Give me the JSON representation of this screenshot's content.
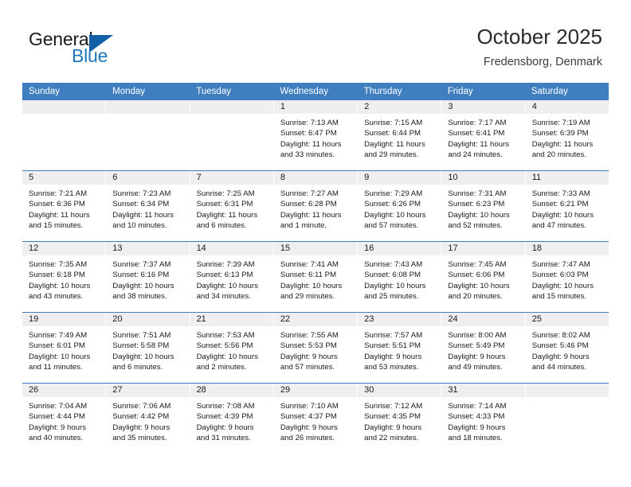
{
  "brand": {
    "name_part1": "General",
    "name_part2": "Blue",
    "accent_color": "#1360a8",
    "text_color": "#1f76bc"
  },
  "header": {
    "title": "October 2025",
    "subtitle": "Fredensborg, Denmark",
    "header_bg_color": "#3f7fbf",
    "date_band_color": "#efefef"
  },
  "weekdays": [
    "Sunday",
    "Monday",
    "Tuesday",
    "Wednesday",
    "Thursday",
    "Friday",
    "Saturday"
  ],
  "weeks": [
    [
      {
        "day": "",
        "empty": true,
        "sunrise": "",
        "sunset": "",
        "daylight1": "",
        "daylight2": ""
      },
      {
        "day": "",
        "empty": true,
        "sunrise": "",
        "sunset": "",
        "daylight1": "",
        "daylight2": ""
      },
      {
        "day": "",
        "empty": true,
        "sunrise": "",
        "sunset": "",
        "daylight1": "",
        "daylight2": ""
      },
      {
        "day": "1",
        "empty": false,
        "sunrise": "Sunrise: 7:13 AM",
        "sunset": "Sunset: 6:47 PM",
        "daylight1": "Daylight: 11 hours",
        "daylight2": "and 33 minutes."
      },
      {
        "day": "2",
        "empty": false,
        "sunrise": "Sunrise: 7:15 AM",
        "sunset": "Sunset: 6:44 PM",
        "daylight1": "Daylight: 11 hours",
        "daylight2": "and 29 minutes."
      },
      {
        "day": "3",
        "empty": false,
        "sunrise": "Sunrise: 7:17 AM",
        "sunset": "Sunset: 6:41 PM",
        "daylight1": "Daylight: 11 hours",
        "daylight2": "and 24 minutes."
      },
      {
        "day": "4",
        "empty": false,
        "sunrise": "Sunrise: 7:19 AM",
        "sunset": "Sunset: 6:39 PM",
        "daylight1": "Daylight: 11 hours",
        "daylight2": "and 20 minutes."
      }
    ],
    [
      {
        "day": "5",
        "empty": false,
        "sunrise": "Sunrise: 7:21 AM",
        "sunset": "Sunset: 6:36 PM",
        "daylight1": "Daylight: 11 hours",
        "daylight2": "and 15 minutes."
      },
      {
        "day": "6",
        "empty": false,
        "sunrise": "Sunrise: 7:23 AM",
        "sunset": "Sunset: 6:34 PM",
        "daylight1": "Daylight: 11 hours",
        "daylight2": "and 10 minutes."
      },
      {
        "day": "7",
        "empty": false,
        "sunrise": "Sunrise: 7:25 AM",
        "sunset": "Sunset: 6:31 PM",
        "daylight1": "Daylight: 11 hours",
        "daylight2": "and 6 minutes."
      },
      {
        "day": "8",
        "empty": false,
        "sunrise": "Sunrise: 7:27 AM",
        "sunset": "Sunset: 6:28 PM",
        "daylight1": "Daylight: 11 hours",
        "daylight2": "and 1 minute."
      },
      {
        "day": "9",
        "empty": false,
        "sunrise": "Sunrise: 7:29 AM",
        "sunset": "Sunset: 6:26 PM",
        "daylight1": "Daylight: 10 hours",
        "daylight2": "and 57 minutes."
      },
      {
        "day": "10",
        "empty": false,
        "sunrise": "Sunrise: 7:31 AM",
        "sunset": "Sunset: 6:23 PM",
        "daylight1": "Daylight: 10 hours",
        "daylight2": "and 52 minutes."
      },
      {
        "day": "11",
        "empty": false,
        "sunrise": "Sunrise: 7:33 AM",
        "sunset": "Sunset: 6:21 PM",
        "daylight1": "Daylight: 10 hours",
        "daylight2": "and 47 minutes."
      }
    ],
    [
      {
        "day": "12",
        "empty": false,
        "sunrise": "Sunrise: 7:35 AM",
        "sunset": "Sunset: 6:18 PM",
        "daylight1": "Daylight: 10 hours",
        "daylight2": "and 43 minutes."
      },
      {
        "day": "13",
        "empty": false,
        "sunrise": "Sunrise: 7:37 AM",
        "sunset": "Sunset: 6:16 PM",
        "daylight1": "Daylight: 10 hours",
        "daylight2": "and 38 minutes."
      },
      {
        "day": "14",
        "empty": false,
        "sunrise": "Sunrise: 7:39 AM",
        "sunset": "Sunset: 6:13 PM",
        "daylight1": "Daylight: 10 hours",
        "daylight2": "and 34 minutes."
      },
      {
        "day": "15",
        "empty": false,
        "sunrise": "Sunrise: 7:41 AM",
        "sunset": "Sunset: 6:11 PM",
        "daylight1": "Daylight: 10 hours",
        "daylight2": "and 29 minutes."
      },
      {
        "day": "16",
        "empty": false,
        "sunrise": "Sunrise: 7:43 AM",
        "sunset": "Sunset: 6:08 PM",
        "daylight1": "Daylight: 10 hours",
        "daylight2": "and 25 minutes."
      },
      {
        "day": "17",
        "empty": false,
        "sunrise": "Sunrise: 7:45 AM",
        "sunset": "Sunset: 6:06 PM",
        "daylight1": "Daylight: 10 hours",
        "daylight2": "and 20 minutes."
      },
      {
        "day": "18",
        "empty": false,
        "sunrise": "Sunrise: 7:47 AM",
        "sunset": "Sunset: 6:03 PM",
        "daylight1": "Daylight: 10 hours",
        "daylight2": "and 15 minutes."
      }
    ],
    [
      {
        "day": "19",
        "empty": false,
        "sunrise": "Sunrise: 7:49 AM",
        "sunset": "Sunset: 6:01 PM",
        "daylight1": "Daylight: 10 hours",
        "daylight2": "and 11 minutes."
      },
      {
        "day": "20",
        "empty": false,
        "sunrise": "Sunrise: 7:51 AM",
        "sunset": "Sunset: 5:58 PM",
        "daylight1": "Daylight: 10 hours",
        "daylight2": "and 6 minutes."
      },
      {
        "day": "21",
        "empty": false,
        "sunrise": "Sunrise: 7:53 AM",
        "sunset": "Sunset: 5:56 PM",
        "daylight1": "Daylight: 10 hours",
        "daylight2": "and 2 minutes."
      },
      {
        "day": "22",
        "empty": false,
        "sunrise": "Sunrise: 7:55 AM",
        "sunset": "Sunset: 5:53 PM",
        "daylight1": "Daylight: 9 hours",
        "daylight2": "and 57 minutes."
      },
      {
        "day": "23",
        "empty": false,
        "sunrise": "Sunrise: 7:57 AM",
        "sunset": "Sunset: 5:51 PM",
        "daylight1": "Daylight: 9 hours",
        "daylight2": "and 53 minutes."
      },
      {
        "day": "24",
        "empty": false,
        "sunrise": "Sunrise: 8:00 AM",
        "sunset": "Sunset: 5:49 PM",
        "daylight1": "Daylight: 9 hours",
        "daylight2": "and 49 minutes."
      },
      {
        "day": "25",
        "empty": false,
        "sunrise": "Sunrise: 8:02 AM",
        "sunset": "Sunset: 5:46 PM",
        "daylight1": "Daylight: 9 hours",
        "daylight2": "and 44 minutes."
      }
    ],
    [
      {
        "day": "26",
        "empty": false,
        "sunrise": "Sunrise: 7:04 AM",
        "sunset": "Sunset: 4:44 PM",
        "daylight1": "Daylight: 9 hours",
        "daylight2": "and 40 minutes."
      },
      {
        "day": "27",
        "empty": false,
        "sunrise": "Sunrise: 7:06 AM",
        "sunset": "Sunset: 4:42 PM",
        "daylight1": "Daylight: 9 hours",
        "daylight2": "and 35 minutes."
      },
      {
        "day": "28",
        "empty": false,
        "sunrise": "Sunrise: 7:08 AM",
        "sunset": "Sunset: 4:39 PM",
        "daylight1": "Daylight: 9 hours",
        "daylight2": "and 31 minutes."
      },
      {
        "day": "29",
        "empty": false,
        "sunrise": "Sunrise: 7:10 AM",
        "sunset": "Sunset: 4:37 PM",
        "daylight1": "Daylight: 9 hours",
        "daylight2": "and 26 minutes."
      },
      {
        "day": "30",
        "empty": false,
        "sunrise": "Sunrise: 7:12 AM",
        "sunset": "Sunset: 4:35 PM",
        "daylight1": "Daylight: 9 hours",
        "daylight2": "and 22 minutes."
      },
      {
        "day": "31",
        "empty": false,
        "sunrise": "Sunrise: 7:14 AM",
        "sunset": "Sunset: 4:33 PM",
        "daylight1": "Daylight: 9 hours",
        "daylight2": "and 18 minutes."
      },
      {
        "day": "",
        "empty": true,
        "sunrise": "",
        "sunset": "",
        "daylight1": "",
        "daylight2": ""
      }
    ]
  ]
}
